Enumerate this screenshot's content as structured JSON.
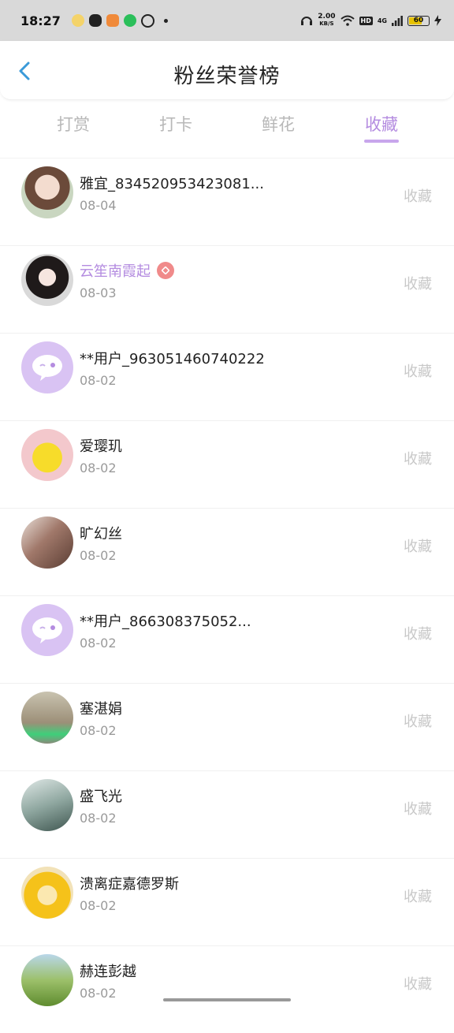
{
  "status": {
    "time": "18:27",
    "speed_value": "2.00",
    "speed_unit": "KB/S",
    "hd": "HD",
    "network": "4G",
    "battery": "60"
  },
  "header": {
    "title": "粉丝荣誉榜"
  },
  "tabs": [
    {
      "label": "打赏"
    },
    {
      "label": "打卡"
    },
    {
      "label": "鲜花"
    },
    {
      "label": "收藏"
    }
  ],
  "active_tab": "收藏",
  "list": [
    {
      "name": "雅宜_834520953423081...",
      "date": "08-04",
      "action": "收藏",
      "avatar": "anime-girl-avatar"
    },
    {
      "name": "云笙南霞起",
      "date": "08-03",
      "action": "收藏",
      "avatar": "anime-girl-dark-hair-avatar",
      "vip": true
    },
    {
      "name": "**用户_963051460740222",
      "date": "08-02",
      "action": "收藏",
      "avatar": "chat-bubble-default-avatar"
    },
    {
      "name": "爱璎玑",
      "date": "08-02",
      "action": "收藏",
      "avatar": "pikachu-avatar"
    },
    {
      "name": "旷幻丝",
      "date": "08-02",
      "action": "收藏",
      "avatar": "girl-photo-avatar"
    },
    {
      "name": "**用户_866308375052...",
      "date": "08-02",
      "action": "收藏",
      "avatar": "chat-bubble-default-avatar"
    },
    {
      "name": "塞湛娟",
      "date": "08-02",
      "action": "收藏",
      "avatar": "girl-outdoor-avatar"
    },
    {
      "name": "盛飞光",
      "date": "08-02",
      "action": "收藏",
      "avatar": "glass-dome-avatar"
    },
    {
      "name": "溃离症嘉德罗斯",
      "date": "08-02",
      "action": "收藏",
      "avatar": "anime-yellow-hair-avatar"
    },
    {
      "name": "赫连彭越",
      "date": "08-02",
      "action": "收藏",
      "avatar": "flowers-avatar"
    }
  ],
  "colors": {
    "accent": "#b48ce0",
    "status_bar": "#d9d9d9",
    "muted_text": "#9a9a9a",
    "action_text": "#c8c8c8"
  }
}
